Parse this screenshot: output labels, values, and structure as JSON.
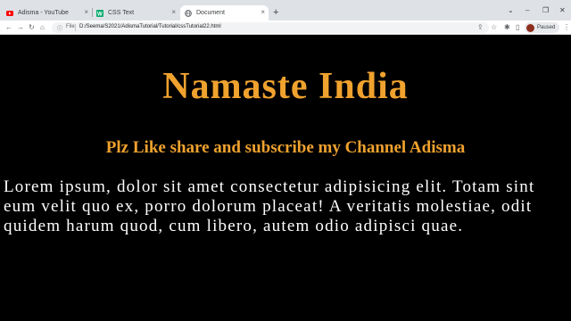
{
  "browser": {
    "tabs": [
      {
        "title": "Adisma - YouTube",
        "icon": "youtube-icon",
        "icon_color": "#ff0000"
      },
      {
        "title": "CSS Text",
        "icon": "w3schools-icon",
        "icon_color": "#04aa6d"
      },
      {
        "title": "Document",
        "icon": "globe-icon",
        "icon_color": "#5f6368"
      }
    ],
    "new_tab": "+",
    "address": {
      "scheme": "File",
      "url": "D:/Seema/S2021/AdismaTutorial/Tutorial/cssTutorial22.html"
    },
    "profile": {
      "status": "Paused",
      "avatar_color": "#8d2f1e"
    }
  },
  "page": {
    "heading": "Namaste India",
    "subheading": "Plz Like share and subscribe my Channel Adisma",
    "paragraph": "Lorem ipsum, dolor sit amet consectetur adipisicing elit. Totam sint eum velit quo ex, porro dolorum placeat! A veritatis molestiae, odit quidem harum quod, cum libero, autem odio adipisci quae.",
    "heading_color": "#f0a22e",
    "text_color": "#ffffff",
    "background": "#000000"
  }
}
